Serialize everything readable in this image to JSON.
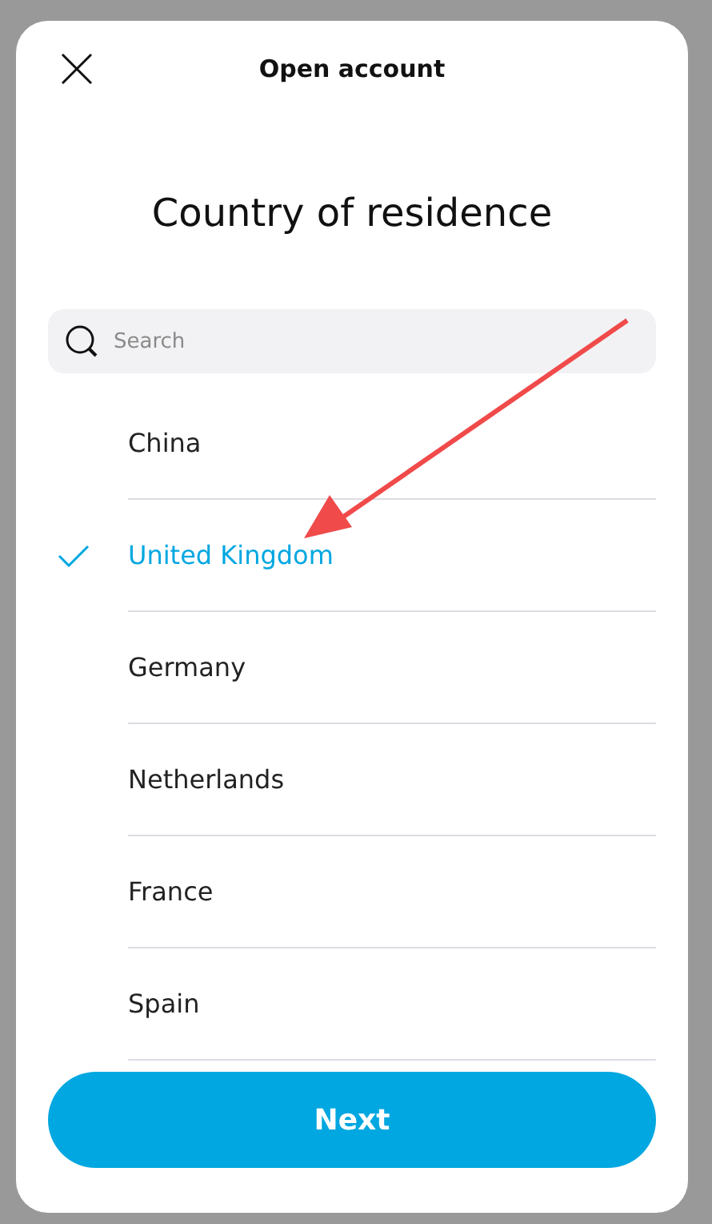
{
  "header": {
    "title": "Open account"
  },
  "heading": "Country of residence",
  "search": {
    "placeholder": "Search"
  },
  "countries": [
    {
      "name": "China",
      "selected": false
    },
    {
      "name": "United Kingdom",
      "selected": true
    },
    {
      "name": "Germany",
      "selected": false
    },
    {
      "name": "Netherlands",
      "selected": false
    },
    {
      "name": "France",
      "selected": false
    },
    {
      "name": "Spain",
      "selected": false
    }
  ],
  "button": "Next"
}
